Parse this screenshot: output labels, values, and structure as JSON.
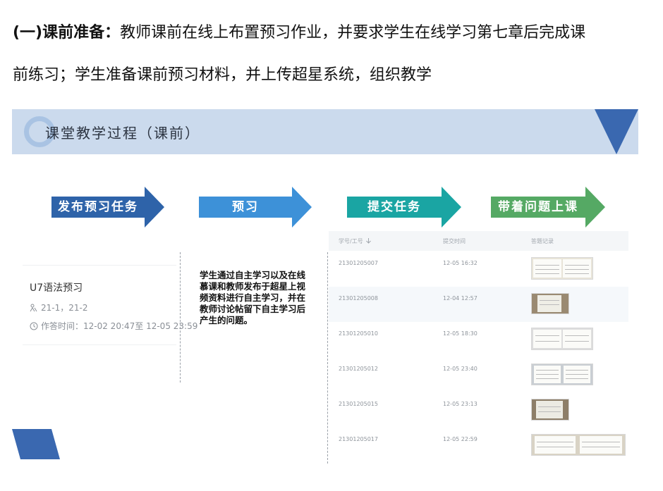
{
  "intro": {
    "heading": "(一)课前准备：",
    "line1": "教师课前在线上布置预习作业，并要求学生在线学习第七章后完成课",
    "line2": "前练习；学生准备课前预习材料，并上传超星系统，组织教学"
  },
  "banner": {
    "title": "课堂教学过程（课前）"
  },
  "steps": [
    {
      "label": "发布预习任务",
      "color": "#2e63a9"
    },
    {
      "label": "预习",
      "color": "#3d91d8"
    },
    {
      "label": "提交任务",
      "color": "#1aa5a3"
    },
    {
      "label": "带着问题上课",
      "color": "#55a964"
    }
  ],
  "homework": {
    "title": "U7语法预习",
    "classes": "21-1，21-2",
    "time": "作答时间：12-02 20:47至 12-05 23:59"
  },
  "description": "学生通过自主学习以及在线慕课和教师发布于超星上视频资料进行自主学习，并在教师讨论帖留下自主学习后产生的问题。",
  "table": {
    "headers": [
      "学号/工号",
      "提交时间",
      "答题记录"
    ],
    "sort_icon": "arrow-down-icon",
    "rows": [
      {
        "id": "21301205007",
        "time": "12-05 16:32"
      },
      {
        "id": "21301205008",
        "time": "12-04 12:57"
      },
      {
        "id": "21301205010",
        "time": "12-05 18:30"
      },
      {
        "id": "21301205012",
        "time": "12-05 23:40"
      },
      {
        "id": "21301205015",
        "time": "12-05 23:13"
      },
      {
        "id": "21301205017",
        "time": "12-05 22:59"
      }
    ]
  },
  "colors": {
    "banner_bg": "#cbdaed",
    "accent_blue": "#2e63a9"
  }
}
